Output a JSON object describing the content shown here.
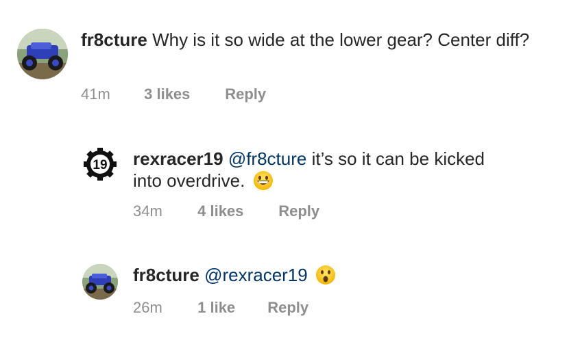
{
  "comments": [
    {
      "username": "fr8cture",
      "mention": "",
      "text": "Why is it so wide at the lower gear? Center diff?",
      "time": "41m",
      "likes": "3 likes",
      "reply_label": "Reply",
      "avatar": "rc-crawler-photo"
    },
    {
      "username": "rexracer19",
      "mention": "@fr8cture",
      "text_line1": "it’s so it can be kicked",
      "text_line2": "into overdrive.",
      "emoji": "grinning-face",
      "time": "34m",
      "likes": "4 likes",
      "reply_label": "Reply",
      "avatar": "gear-19-logo",
      "logo_number": "19"
    },
    {
      "username": "fr8cture",
      "mention": "@rexracer19",
      "emoji": "surprised-face",
      "time": "26m",
      "likes": "1 like",
      "reply_label": "Reply",
      "avatar": "rc-crawler-photo"
    }
  ],
  "colors": {
    "text": "#262626",
    "meta": "#8e8e8e",
    "mention": "#003569"
  }
}
